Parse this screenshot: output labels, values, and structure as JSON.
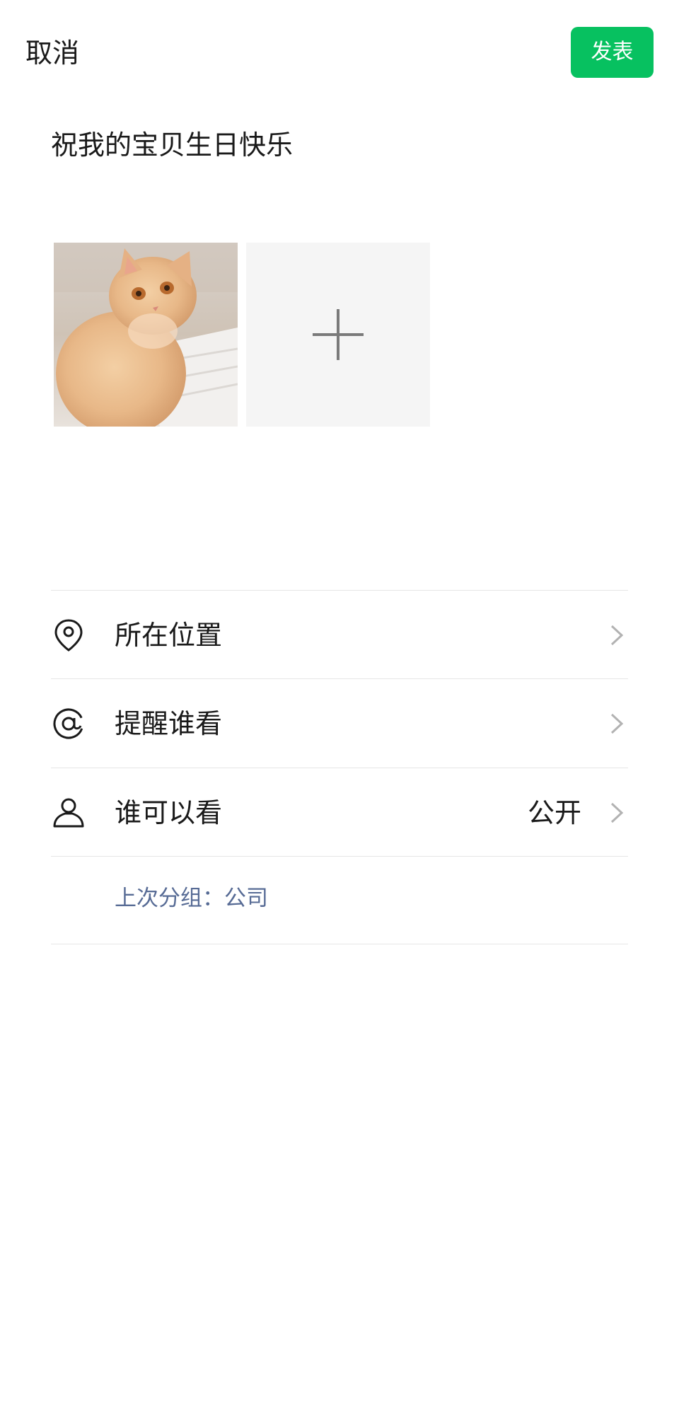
{
  "header": {
    "cancel_label": "取消",
    "publish_label": "发表"
  },
  "post": {
    "text": "祝我的宝贝生日快乐"
  },
  "photos": {
    "items": [
      {
        "name": "cat-photo"
      }
    ],
    "add_icon": "plus-icon"
  },
  "options": [
    {
      "label": "所在位置",
      "icon": "location-pin-icon",
      "value": ""
    },
    {
      "label": "提醒谁看",
      "icon": "at-icon",
      "value": ""
    },
    {
      "label": "谁可以看",
      "icon": "user-icon",
      "value": "公开"
    }
  ],
  "last_group": {
    "text": "上次分组：公司"
  },
  "colors": {
    "accent_green": "#07c160",
    "link_blue": "#576b95",
    "divider": "#e6e6e6",
    "add_tile_bg": "#f5f5f5"
  }
}
